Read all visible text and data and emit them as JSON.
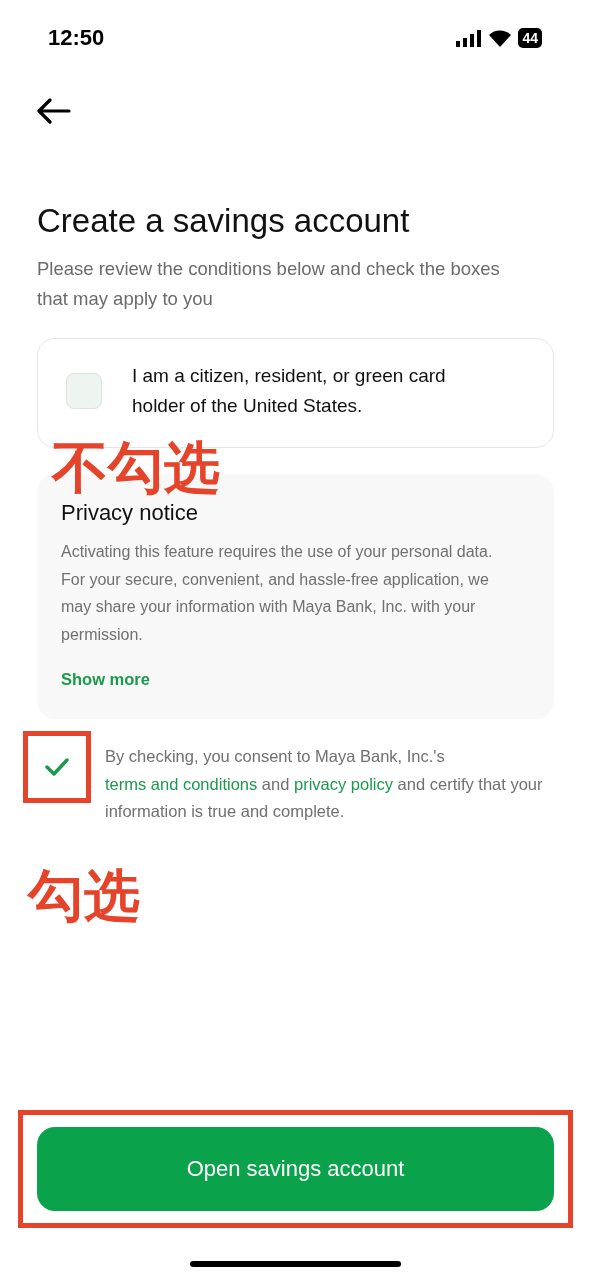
{
  "status_bar": {
    "time": "12:50",
    "battery": "44"
  },
  "title": "Create a savings account",
  "subtitle": "Please review the conditions below and check the boxes that may apply to you",
  "citizen_option": {
    "label": "I am a citizen, resident, or green card holder of the United States.",
    "checked": false
  },
  "privacy": {
    "heading": "Privacy notice",
    "body": "Activating this feature requires the use of your personal data. For your secure, convenient, and hassle-free application, we may share your information with Maya Bank, Inc. with your permission.",
    "link": "Show more"
  },
  "consent": {
    "checked": true,
    "before": "By checking, you consent to Maya Bank, Inc.'s",
    "terms": "terms and conditions",
    "and": "and",
    "policy": "privacy policy",
    "after": "and certify that your information is true and complete."
  },
  "button": "Open savings account",
  "annotations": [
    {
      "text": "不勾选"
    },
    {
      "text": "勾选"
    }
  ]
}
